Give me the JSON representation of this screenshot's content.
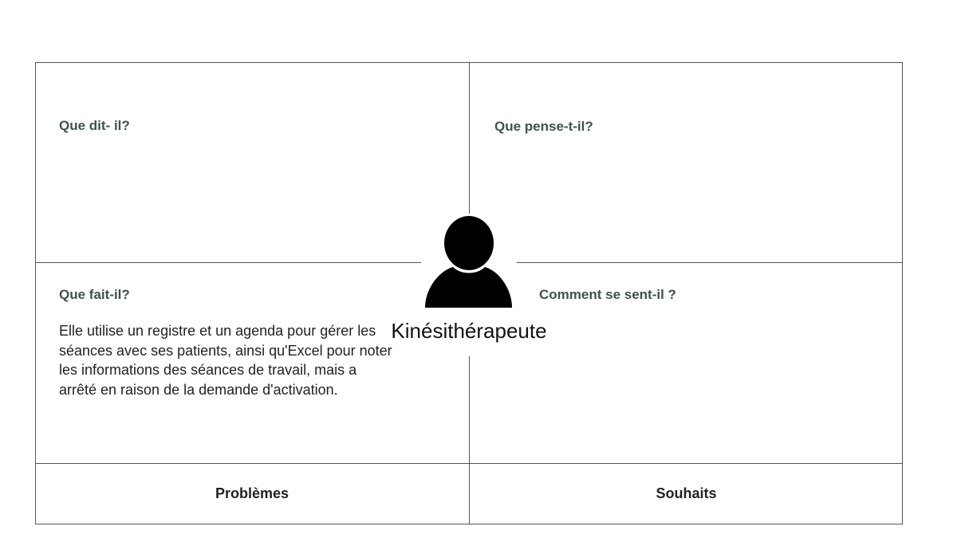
{
  "persona": {
    "label": "Kinésithérapeute",
    "icon": "user-silhouette-icon"
  },
  "quadrants": {
    "says": {
      "heading": "Que dit- il?"
    },
    "thinks": {
      "heading": "Que pense-t-il?"
    },
    "does": {
      "heading": "Que fait-il?",
      "text": "Elle utilise un registre et un agenda pour gérer les séances avec ses patients, ainsi qu'Excel pour noter les informations des séances de travail, mais a arrêté en raison de la demande d'activation."
    },
    "feels": {
      "heading": "Comment se sent-il ?"
    }
  },
  "footer": {
    "problems": "Problèmes",
    "wishes": "Souhaits"
  },
  "colors": {
    "heading": "#3d5448",
    "border": "#555555",
    "icon": "#000000"
  }
}
